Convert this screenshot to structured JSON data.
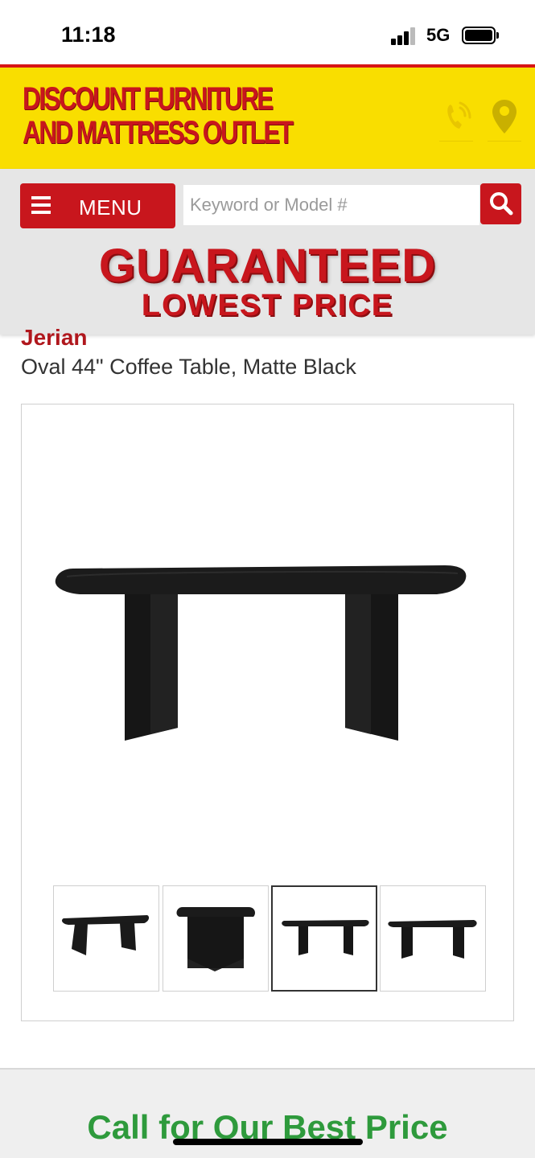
{
  "status_bar": {
    "time": "11:18",
    "network": "5G"
  },
  "header": {
    "logo_line1": "DISCOUNT FURNITURE",
    "logo_line2": "AND MATTRESS OUTLET",
    "icons": [
      "phone-icon",
      "location-pin-icon"
    ],
    "colors": {
      "background": "#f9de00",
      "accent": "#c8161d"
    }
  },
  "nav": {
    "menu_label": "MENU",
    "search_placeholder": "Keyword or Model #",
    "guarantee_line1": "GUARANTEED",
    "guarantee_line2": "LOWEST PRICE"
  },
  "product": {
    "brand": "Jerian",
    "title": "Oval 44\" Coffee Table, Matte Black",
    "thumbnails": [
      "angled-view",
      "end-view",
      "front-view",
      "side-view"
    ],
    "active_thumbnail": 3
  },
  "cta": {
    "label": "Call for Our Best Price",
    "color": "#2e9a3c"
  }
}
